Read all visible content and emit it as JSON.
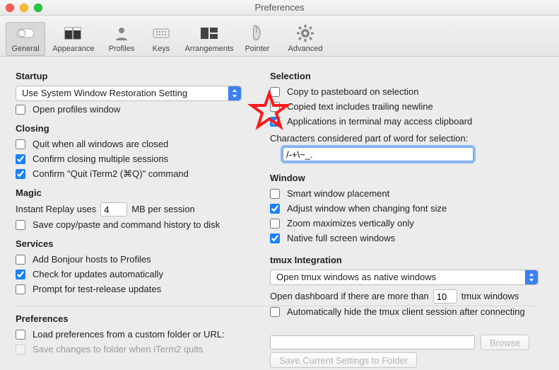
{
  "window": {
    "title": "Preferences"
  },
  "toolbar": {
    "items": [
      {
        "label": "General"
      },
      {
        "label": "Appearance"
      },
      {
        "label": "Profiles"
      },
      {
        "label": "Keys"
      },
      {
        "label": "Arrangements"
      },
      {
        "label": "Pointer"
      },
      {
        "label": "Advanced"
      }
    ]
  },
  "startup": {
    "title": "Startup",
    "dropdown": "Use System Window Restoration Setting",
    "open_profiles": "Open profiles window"
  },
  "closing": {
    "title": "Closing",
    "quit_all": "Quit when all windows are closed",
    "confirm_multi": "Confirm closing multiple sessions",
    "confirm_quit": "Confirm \"Quit iTerm2 (⌘Q)\" command"
  },
  "magic": {
    "title": "Magic",
    "instant_label_pre": "Instant Replay uses",
    "instant_value": "4",
    "instant_label_post": "MB per session",
    "save_copy": "Save copy/paste and command history to disk"
  },
  "services": {
    "title": "Services",
    "bonjour": "Add Bonjour hosts to Profiles",
    "updates": "Check for updates automatically",
    "test": "Prompt for test-release updates"
  },
  "prefs": {
    "title": "Preferences",
    "load": "Load preferences from a custom folder or URL:",
    "save": "Save changes to folder when iTerm2 quits",
    "browse": "Browse",
    "save_btn": "Save Current Settings to Folder"
  },
  "selection": {
    "title": "Selection",
    "copy_paste": "Copy to pasteboard on selection",
    "trailing": "Copied text includes trailing newline",
    "apps": "Applications in terminal may access clipboard",
    "chars_label": "Characters considered part of word for selection:",
    "chars_value": "/-+\\~_."
  },
  "windowsec": {
    "title": "Window",
    "smart": "Smart window placement",
    "adjust": "Adjust window when changing font size",
    "zoom": "Zoom maximizes vertically only",
    "native": "Native full screen windows"
  },
  "tmux": {
    "title": "tmux Integration",
    "dropdown": "Open tmux windows as native windows",
    "dash_pre": "Open dashboard if there are more than",
    "dash_value": "10",
    "dash_post": "tmux windows",
    "autohide": "Automatically hide the tmux client session after connecting"
  }
}
